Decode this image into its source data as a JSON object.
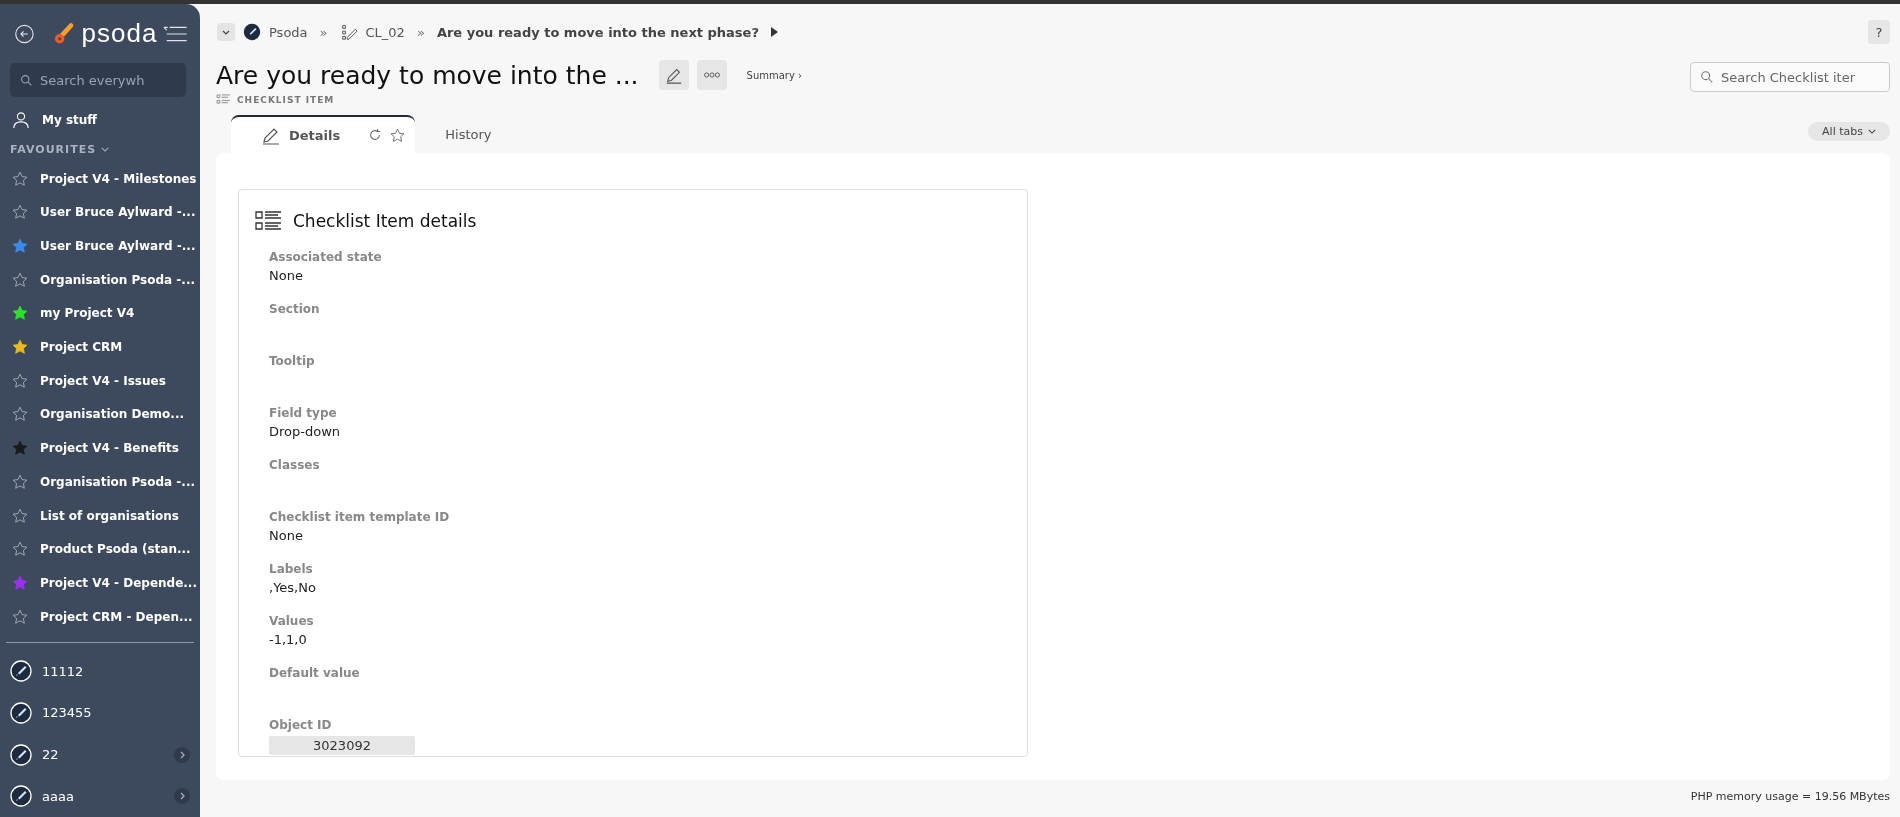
{
  "sidebar": {
    "logo": "psoda",
    "search": {
      "placeholder": "Search everywh"
    },
    "my_stuff": "My stuff",
    "favourites_heading": "FAVOURITES",
    "favourites": [
      {
        "label": "Project V4 - Milestones"
      },
      {
        "label": "User Bruce Aylward -..."
      },
      {
        "label": "User Bruce Aylward -...",
        "color": "#3b8beb"
      },
      {
        "label": "Organisation Psoda -..."
      },
      {
        "label": "my Project V4",
        "color": "#2ee02e"
      },
      {
        "label": "Project CRM",
        "color": "#e8b923"
      },
      {
        "label": "Project V4 - Issues"
      },
      {
        "label": "Organisation Demo..."
      },
      {
        "label": "Project V4 - Benefits",
        "color": "#1a1a1a"
      },
      {
        "label": "Organisation Psoda -..."
      },
      {
        "label": "List of organisations"
      },
      {
        "label": "Product Psoda (stan..."
      },
      {
        "label": "Project V4 - Depende...",
        "color": "#9b30f0"
      },
      {
        "label": "Project CRM - Depen..."
      }
    ],
    "projects": [
      {
        "label": "11112",
        "expandable": false
      },
      {
        "label": "123455",
        "expandable": false
      },
      {
        "label": "22",
        "expandable": true
      },
      {
        "label": "aaaa",
        "expandable": true
      }
    ]
  },
  "breadcrumb": [
    {
      "label": "Psoda",
      "kind": "org"
    },
    {
      "label": "CL_02",
      "kind": "checklist",
      "separator": "»"
    },
    {
      "label": "Are you ready to move into the next phase?",
      "kind": "current",
      "separator": "»"
    }
  ],
  "help": "?",
  "title": "Are you ready to move into the ...",
  "summary": "Summary ›",
  "type_label": "CHECKLIST ITEM",
  "search": {
    "placeholder": "Search Checklist iter"
  },
  "tabs": [
    {
      "label": "Details",
      "selected": true
    },
    {
      "label": "History",
      "selected": false
    }
  ],
  "all_tabs": "All tabs",
  "card": {
    "title": "Checklist Item details",
    "fields": [
      {
        "label": "Associated state",
        "value": "None"
      },
      {
        "label": "Section"
      },
      {
        "label": "Tooltip"
      },
      {
        "label": "Field type",
        "value": "Drop-down"
      },
      {
        "label": "Classes"
      },
      {
        "label": "Checklist item template ID",
        "value": "None"
      },
      {
        "label": "Labels",
        "value": ",Yes,No"
      },
      {
        "label": "Values",
        "value": "-1,1,0"
      },
      {
        "label": "Default value"
      },
      {
        "label": "Object ID",
        "value": "3023092",
        "kind": "readonly"
      }
    ]
  },
  "footer": "PHP memory usage = 19.56 MBytes"
}
